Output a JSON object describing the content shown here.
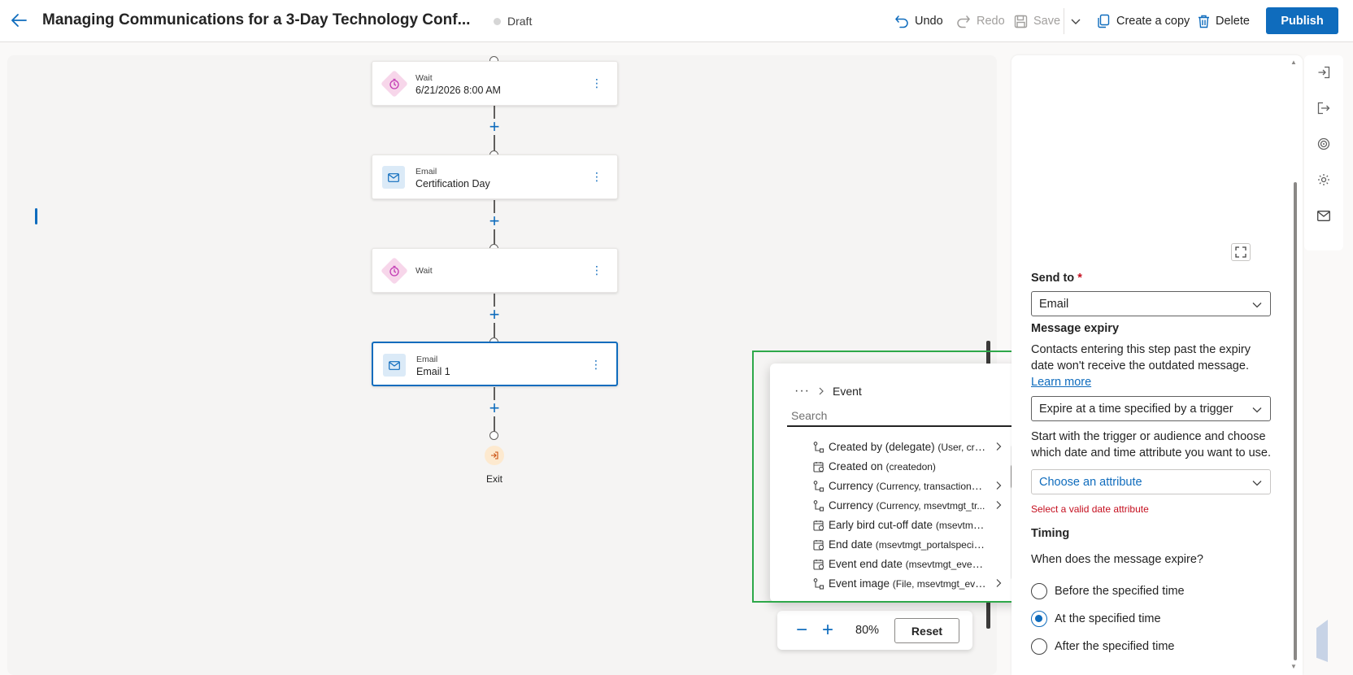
{
  "header": {
    "title": "Managing Communications for a 3-Day Technology Conf...",
    "status": "Draft",
    "undo": "Undo",
    "redo": "Redo",
    "save": "Save",
    "create_copy": "Create a copy",
    "delete": "Delete",
    "publish": "Publish"
  },
  "canvas": {
    "nodes": [
      {
        "type": "Wait",
        "name": "6/21/2026 8:00 AM"
      },
      {
        "type": "Email",
        "name": "Certification Day"
      },
      {
        "type": "",
        "name": "Wait"
      },
      {
        "type": "Email",
        "name": "Email 1"
      }
    ],
    "exit_label": "Exit",
    "zoom_level": "80%",
    "reset": "Reset"
  },
  "attribute_picker": {
    "crumb_dots": "···",
    "crumb_label": "Event",
    "search_placeholder": "Search",
    "items": [
      {
        "name": "Created by (delegate) ",
        "detail": "(User, cre...",
        "icon": "relation-icon",
        "has_children": true
      },
      {
        "name": "Created on ",
        "detail": "(createdon)",
        "icon": "calendar-icon",
        "has_children": false
      },
      {
        "name": "Currency ",
        "detail": "(Currency, transactioncu...",
        "icon": "relation-icon",
        "has_children": true
      },
      {
        "name": "Currency ",
        "detail": "(Currency, msevtmgt_tr...",
        "icon": "relation-icon",
        "has_children": true
      },
      {
        "name": "Early bird cut-off date ",
        "detail": "(msevtmgt...",
        "icon": "calendar-icon",
        "has_children": false
      },
      {
        "name": "End date ",
        "detail": "(msevtmgt_portalspecifice...",
        "icon": "calendar-icon",
        "has_children": false
      },
      {
        "name": "Event end date ",
        "detail": "(msevtmgt_evente...",
        "icon": "calendar-icon",
        "has_children": false
      },
      {
        "name": "Event image ",
        "detail": "(File, msevtmgt_eve...",
        "icon": "relation-icon",
        "has_children": true
      }
    ]
  },
  "properties": {
    "send_to_label": "Send to",
    "send_to_required": "*",
    "send_to_value": "Email",
    "expiry_label": "Message expiry",
    "expiry_desc": "Contacts entering this step past the expiry date won't receive the outdated message. ",
    "learn_more": "Learn more",
    "expiry_value": "Expire at a time specified by a trigger",
    "trigger_desc": "Start with the trigger or audience and choose which date and time attribute you want to use.",
    "attribute_placeholder": "Choose an attribute",
    "attribute_error": "Select a valid date attribute",
    "timing_label": "Timing",
    "timing_question": "When does the message expire?",
    "timing_options": [
      {
        "label": "Before the specified time",
        "checked": false
      },
      {
        "label": "At the specified time",
        "checked": true
      },
      {
        "label": "After the specified time",
        "checked": false
      }
    ]
  },
  "colors": {
    "accent": "#0f6cbd",
    "highlight": "#2ea84a",
    "error": "#c50f1f"
  }
}
